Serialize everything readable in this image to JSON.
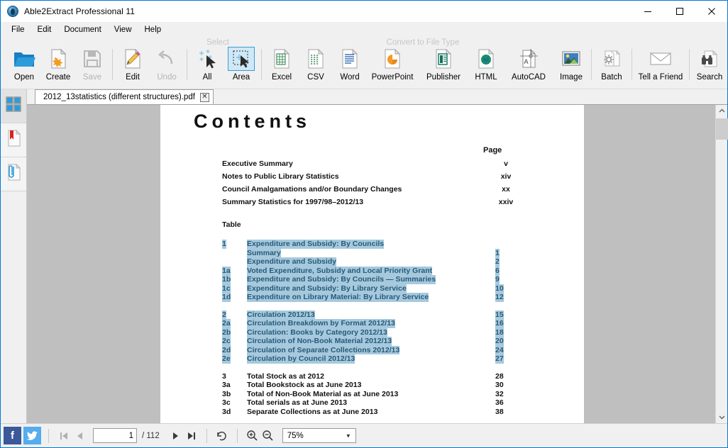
{
  "window": {
    "title": "Able2Extract Professional 11",
    "app_icon": "app-logo-icon",
    "minimize": "minimize-icon",
    "maximize": "maximize-icon",
    "close": "close-icon"
  },
  "menubar": {
    "items": [
      {
        "label": "File"
      },
      {
        "label": "Edit"
      },
      {
        "label": "Document"
      },
      {
        "label": "View"
      },
      {
        "label": "Help"
      }
    ]
  },
  "ribbon": {
    "group_captions": {
      "select": "Select",
      "convert": "Convert to File Type"
    },
    "buttons": [
      {
        "label": "Open",
        "icon": "open-folder-icon",
        "state": "enabled"
      },
      {
        "label": "Create",
        "icon": "create-pdf-icon",
        "state": "enabled"
      },
      {
        "label": "Save",
        "icon": "save-floppy-icon",
        "state": "disabled"
      },
      {
        "label": "Edit",
        "icon": "edit-pencil-icon",
        "state": "enabled"
      },
      {
        "label": "Undo",
        "icon": "undo-arrow-icon",
        "state": "disabled"
      },
      {
        "label": "All",
        "icon": "select-all-icon",
        "state": "enabled"
      },
      {
        "label": "Area",
        "icon": "select-area-icon",
        "state": "selected"
      },
      {
        "label": "Excel",
        "icon": "excel-icon",
        "state": "enabled"
      },
      {
        "label": "CSV",
        "icon": "csv-icon",
        "state": "enabled"
      },
      {
        "label": "Word",
        "icon": "word-icon",
        "state": "enabled"
      },
      {
        "label": "PowerPoint",
        "icon": "powerpoint-icon",
        "state": "enabled"
      },
      {
        "label": "Publisher",
        "icon": "publisher-icon",
        "state": "enabled"
      },
      {
        "label": "HTML",
        "icon": "html-icon",
        "state": "enabled"
      },
      {
        "label": "AutoCAD",
        "icon": "autocad-icon",
        "state": "enabled"
      },
      {
        "label": "Image",
        "icon": "image-icon",
        "state": "enabled"
      },
      {
        "label": "Batch",
        "icon": "batch-gear-icon",
        "state": "enabled"
      },
      {
        "label": "Tell a Friend",
        "icon": "envelope-icon",
        "state": "enabled"
      },
      {
        "label": "Search",
        "icon": "binoculars-icon",
        "state": "enabled"
      }
    ]
  },
  "leftrail": {
    "items": [
      {
        "icon": "thumbnails-icon",
        "active": true
      },
      {
        "icon": "bookmarks-icon",
        "active": false
      },
      {
        "icon": "attachments-icon",
        "active": false
      }
    ]
  },
  "tab": {
    "filename": "2012_13statistics (different structures).pdf",
    "close_label": "✕"
  },
  "document": {
    "heading": "Contents",
    "page_column_header": "Page",
    "front_matter": [
      {
        "title": "Executive Summary",
        "page": "v"
      },
      {
        "title": "Notes to Public Library Statistics",
        "page": "xiv"
      },
      {
        "title": "Council Amalgamations and/or Boundary Changes",
        "page": "xx"
      },
      {
        "title": "Summary Statistics for 1997/98–2012/13",
        "page": "xxiv"
      }
    ],
    "table_label": "Table",
    "toc": [
      {
        "num": "1",
        "title": "Expenditure and Subsidy: By Councils",
        "page": "",
        "selected": true
      },
      {
        "num": "",
        "title": "Summary",
        "page": "1",
        "selected": true
      },
      {
        "num": "",
        "title": "Expenditure and Subsidy",
        "page": "2",
        "selected": true
      },
      {
        "num": "1a",
        "title": "Voted Expenditure, Subsidy and Local Priority Grant",
        "page": "6",
        "selected": true
      },
      {
        "num": "1b",
        "title": "Expenditure and Subsidy: By Councils — Summaries",
        "page": "9",
        "selected": true
      },
      {
        "num": "1c",
        "title": "Expenditure and Subsidy: By Library Service",
        "page": "10",
        "selected": true
      },
      {
        "num": "1d",
        "title": "Expenditure on Library Material: By Library Service",
        "page": "12",
        "selected": true
      },
      {
        "gap": true
      },
      {
        "num": "2",
        "title": "Circulation 2012/13",
        "page": "15",
        "selected": true
      },
      {
        "num": "2a",
        "title": "Circulation Breakdown by Format 2012/13",
        "page": "16",
        "selected": true
      },
      {
        "num": "2b",
        "title": "Circulation: Books by Category 2012/13",
        "page": "18",
        "selected": true
      },
      {
        "num": "2c",
        "title": "Circulation of Non-Book Material 2012/13",
        "page": "20",
        "selected": true
      },
      {
        "num": "2d",
        "title": "Circulation of Separate Collections 2012/13",
        "page": "24",
        "selected": true
      },
      {
        "num": "2e",
        "title": "Circulation by Council 2012/13",
        "page": "27",
        "selected": true
      },
      {
        "gap": true
      },
      {
        "num": "3",
        "title": "Total Stock as at 2012",
        "page": "28",
        "selected": false
      },
      {
        "num": "3a",
        "title": "Total Bookstock as at June 2013",
        "page": "30",
        "selected": false
      },
      {
        "num": "3b",
        "title": "Total of Non-Book Material as at June 2013",
        "page": "32",
        "selected": false
      },
      {
        "num": "3c",
        "title": "Total serials as at June 2013",
        "page": "36",
        "selected": false
      },
      {
        "num": "3d",
        "title": " Separate Collections as at June 2013",
        "page": "38",
        "selected": false
      }
    ]
  },
  "statusbar": {
    "facebook_icon": "facebook-icon",
    "facebook_glyph": "f",
    "twitter_icon": "twitter-icon",
    "first_page_icon": "first-page-icon",
    "prev_page_icon": "previous-page-icon",
    "next_page_icon": "next-page-icon",
    "last_page_icon": "last-page-icon",
    "rotate_icon": "rotate-icon",
    "zoom_in_icon": "zoom-in-icon",
    "zoom_out_icon": "zoom-out-icon",
    "page_value": "1",
    "page_placeholder": "1",
    "page_total": "/ 112",
    "zoom_value": "75%",
    "zoom_caret": "▼"
  },
  "colors": {
    "accent": "#0078d7",
    "selection_bg": "#a6c9de",
    "selection_text": "#275a77",
    "canvas_bg": "#bfbfbf",
    "chrome_bg": "#f0f0f0"
  }
}
